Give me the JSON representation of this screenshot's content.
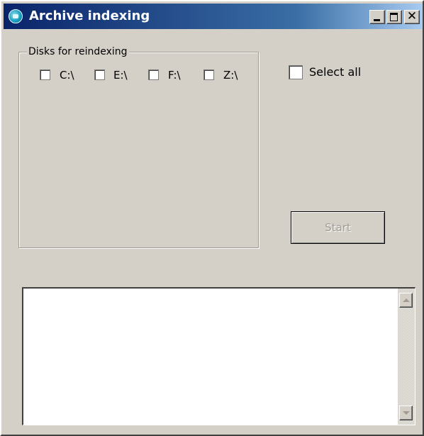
{
  "window": {
    "title": "Archive indexing",
    "close_glyph": "✕"
  },
  "disks_group": {
    "label": "Disks for reindexing",
    "disks": [
      {
        "label": "C:\\",
        "checked": false
      },
      {
        "label": "E:\\",
        "checked": false
      },
      {
        "label": "F:\\",
        "checked": false
      },
      {
        "label": "Z:\\",
        "checked": false
      }
    ]
  },
  "select_all": {
    "label": "Select all",
    "checked": false
  },
  "start_button": {
    "label": "Start",
    "enabled": false
  },
  "log_area": {
    "value": ""
  }
}
